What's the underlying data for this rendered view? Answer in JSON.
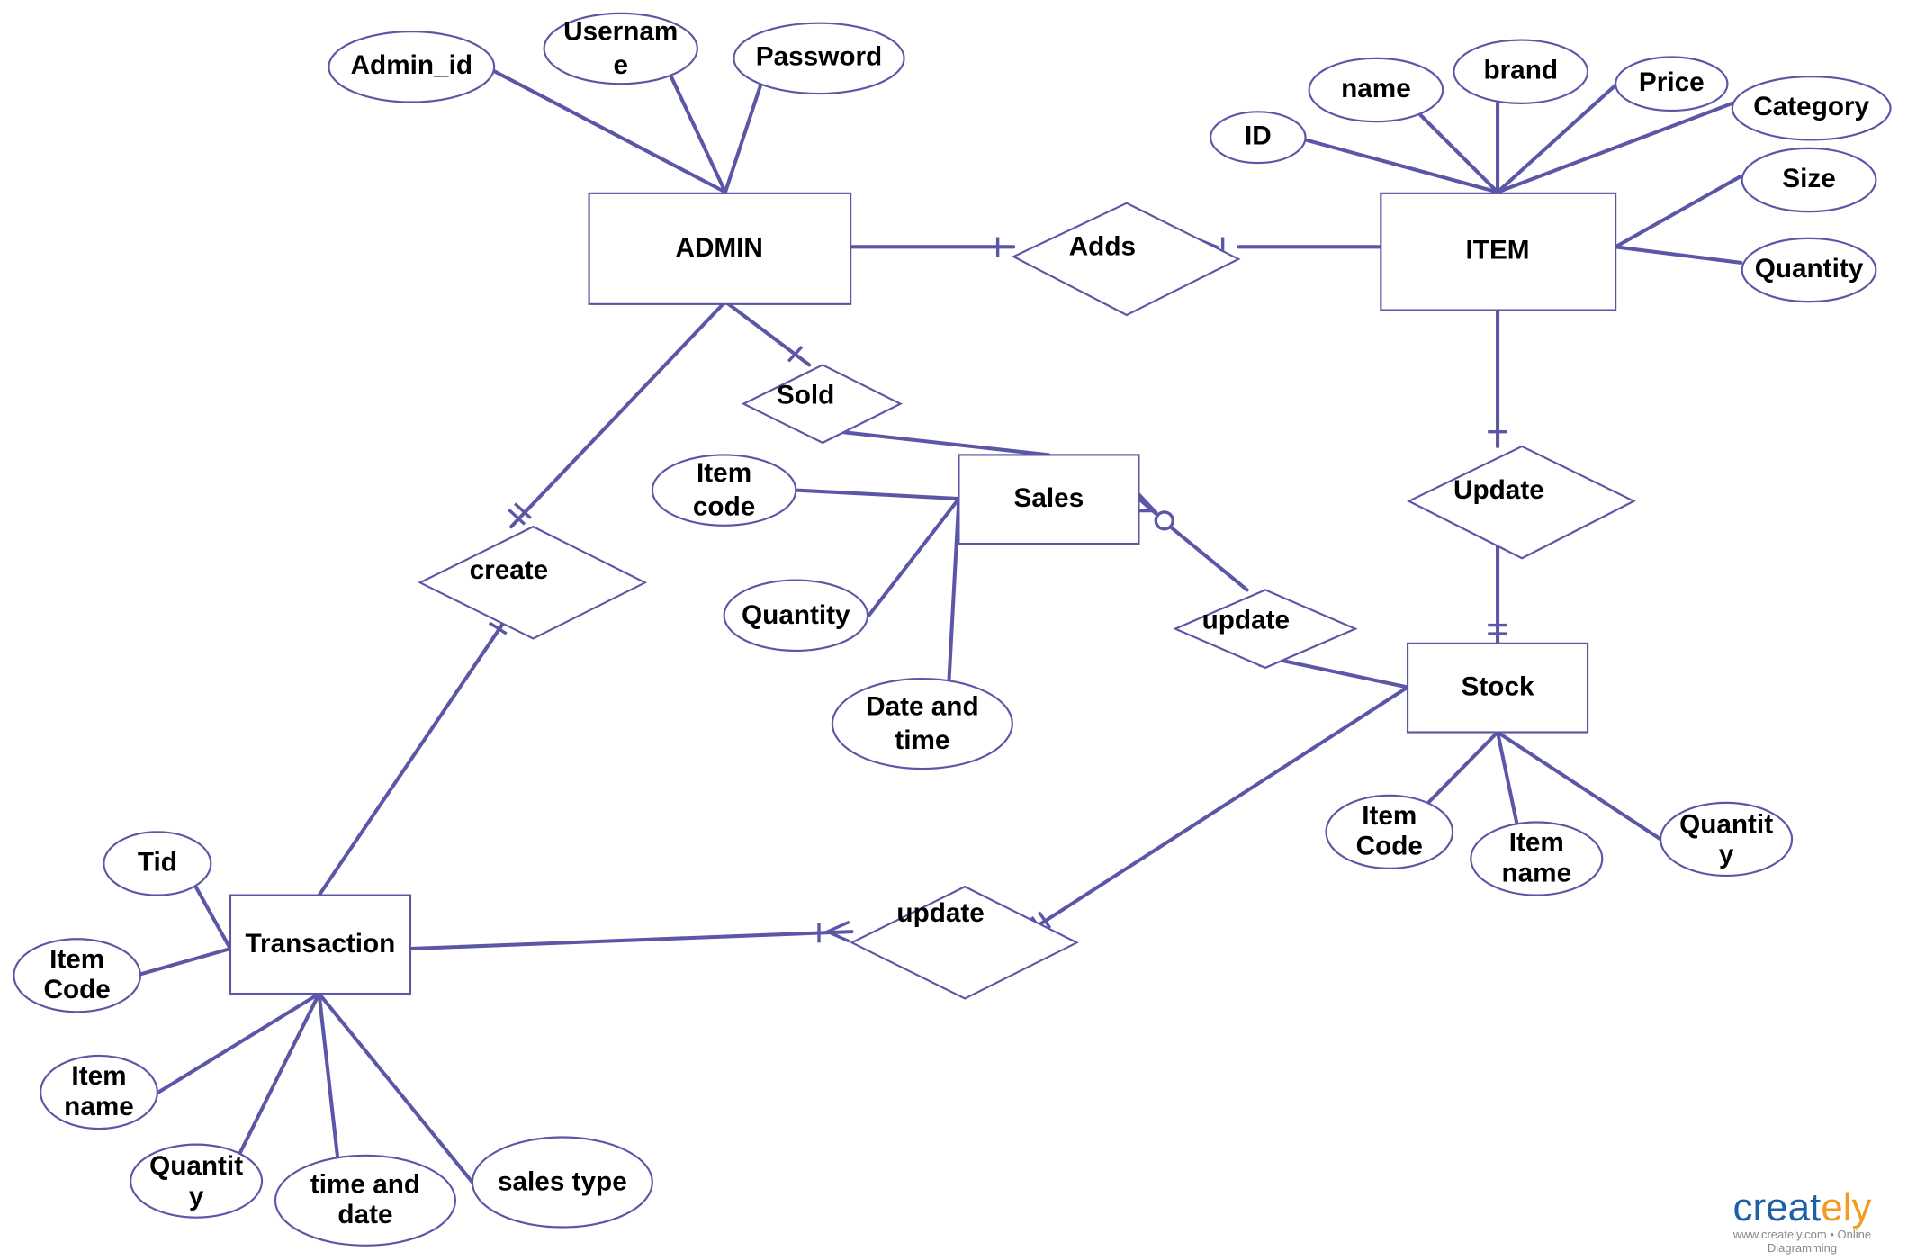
{
  "entities": {
    "admin": "ADMIN",
    "item": "ITEM",
    "sales": "Sales",
    "stock": "Stock",
    "transaction": "Transaction"
  },
  "relationships": {
    "adds": "Adds",
    "sold": "Sold",
    "create": "create",
    "update_item_stock": "Update",
    "update_sales_stock": "update",
    "update_transaction_stock": "update"
  },
  "attributes": {
    "admin": {
      "admin_id": "Admin_id",
      "username": [
        "Usernam",
        "e"
      ],
      "password": "Password"
    },
    "item": {
      "id": "ID",
      "name": "name",
      "brand": "brand",
      "price": "Price",
      "category": "Category",
      "size": "Size",
      "quantity": "Quantity"
    },
    "sales": {
      "item_code": [
        "Item",
        "code"
      ],
      "quantity": "Quantity",
      "date_time": [
        "Date and",
        "time"
      ]
    },
    "stock": {
      "item_code": [
        "Item",
        "Code"
      ],
      "item_name": [
        "Item",
        "name"
      ],
      "quantity": [
        "Quantit",
        "y"
      ]
    },
    "transaction": {
      "tid": "Tid",
      "item_code": [
        "Item",
        "Code"
      ],
      "item_name": [
        "Item",
        "name"
      ],
      "quantity": [
        "Quantit",
        "y"
      ],
      "time_date": [
        "time and",
        "date"
      ],
      "sales_type": "sales type"
    }
  },
  "watermark": {
    "logo_main": "creat",
    "logo_accent": "ely",
    "tagline": "www.creately.com • Online Diagramming"
  },
  "colors": {
    "stroke": "#5b57a6",
    "logo_blue": "#1f5fa8",
    "logo_orange": "#f39b1f"
  }
}
